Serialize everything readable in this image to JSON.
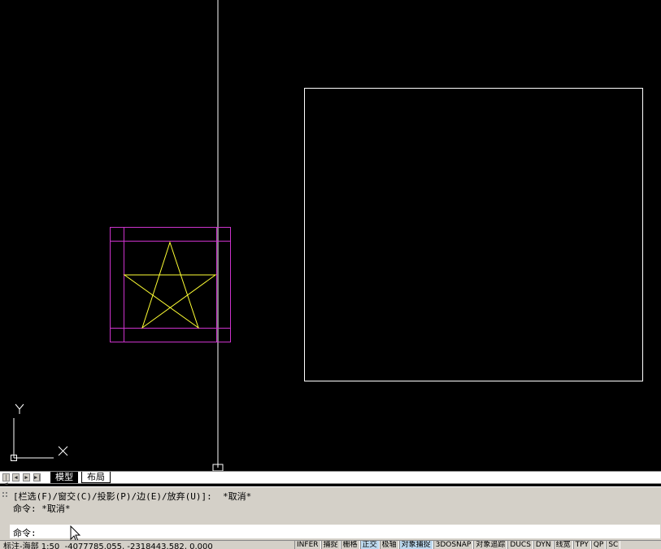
{
  "tabs": {
    "model_label": "模型",
    "layout_label": "布局"
  },
  "command": {
    "line1": "[栏选(F)/窗交(C)/投影(P)/边(E)/放弃(U)]:  *取消*",
    "line2": "命令: *取消*",
    "prompt": "命令:"
  },
  "ucs": {
    "x_label": "X",
    "y_label": "Y"
  },
  "status": {
    "coordinates": "标注-海部 1:50  -4077785.055, -2318443.582, 0.000",
    "toggles": [
      {
        "label": "INFER",
        "on": false
      },
      {
        "label": "捕捉",
        "on": false
      },
      {
        "label": "栅格",
        "on": false
      },
      {
        "label": "正交",
        "on": true
      },
      {
        "label": "极轴",
        "on": false
      },
      {
        "label": "对象捕捉",
        "on": true
      },
      {
        "label": "3DOSNAP",
        "on": false
      },
      {
        "label": "对象追踪",
        "on": false
      },
      {
        "label": "DUCS",
        "on": false
      },
      {
        "label": "DYN",
        "on": false
      },
      {
        "label": "线宽",
        "on": false
      },
      {
        "label": "TPY",
        "on": false
      },
      {
        "label": "QP",
        "on": false
      },
      {
        "label": "SC",
        "on": false
      }
    ]
  },
  "colors": {
    "canvas": "#000000",
    "crosshair": "#ffffff",
    "block_frame": "#cc33cc",
    "star": "#ffff33",
    "rectangle": "#ffffff"
  }
}
